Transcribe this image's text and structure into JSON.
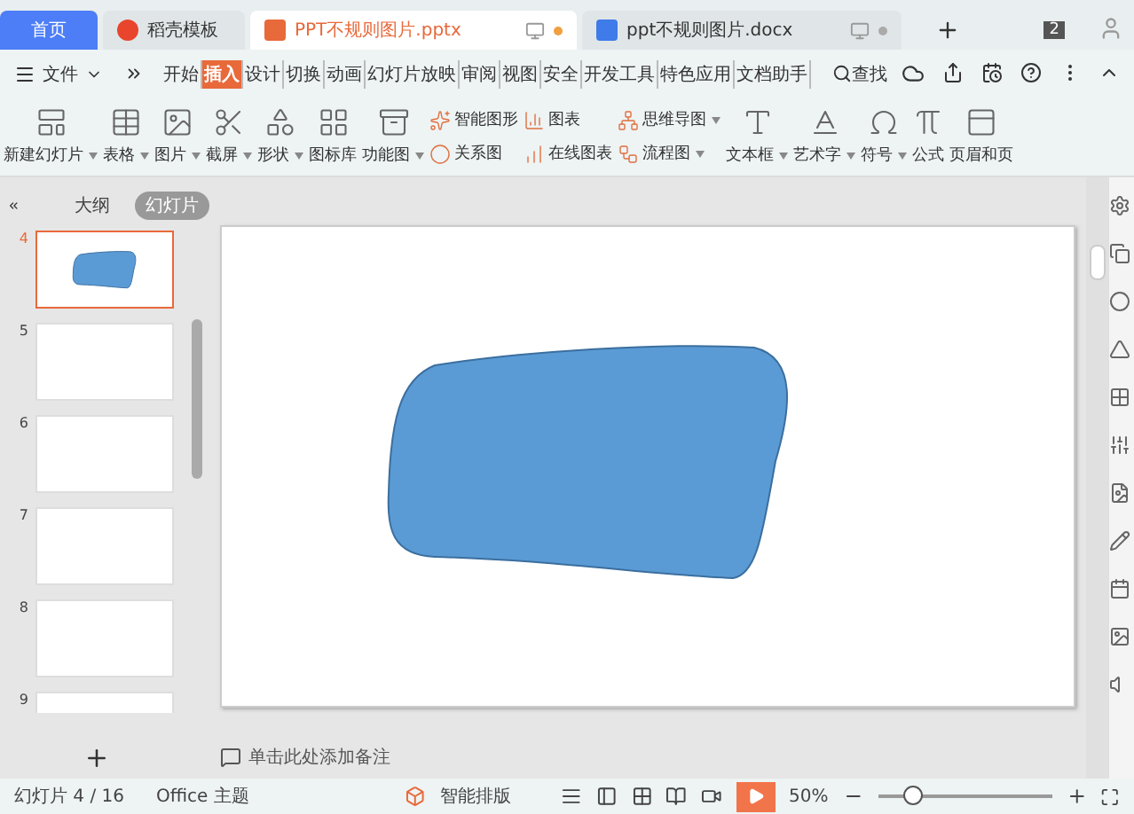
{
  "tabs": [
    {
      "label": "首页",
      "kind": "home",
      "selected": false
    },
    {
      "label": "稻壳模板",
      "kind": "docer",
      "selected": false
    },
    {
      "label": "PPT不规则图片.pptx",
      "kind": "ppt",
      "selected": true
    },
    {
      "label": "ppt不规则图片.docx",
      "kind": "doc",
      "selected": false
    }
  ],
  "window_count": "2",
  "menu": {
    "file": "文件",
    "items": [
      {
        "label": "开始",
        "selected": false
      },
      {
        "label": "插入",
        "selected": true
      },
      {
        "label": "设计",
        "selected": false
      },
      {
        "label": "切换",
        "selected": false
      },
      {
        "label": "动画",
        "selected": false
      },
      {
        "label": "幻灯片放映",
        "selected": false
      },
      {
        "label": "审阅",
        "selected": false
      },
      {
        "label": "视图",
        "selected": false
      },
      {
        "label": "安全",
        "selected": false
      },
      {
        "label": "开发工具",
        "selected": false
      },
      {
        "label": "特色应用",
        "selected": false
      },
      {
        "label": "文档助手",
        "selected": false
      }
    ],
    "search": "查找"
  },
  "ribbon": [
    {
      "kind": "big",
      "label": "新建幻灯片",
      "dropdown": true
    },
    {
      "kind": "big",
      "label": "表格",
      "dropdown": true
    },
    {
      "kind": "big",
      "label": "图片",
      "dropdown": true
    },
    {
      "kind": "big",
      "label": "截屏",
      "dropdown": true
    },
    {
      "kind": "big",
      "label": "形状",
      "dropdown": true
    },
    {
      "kind": "big",
      "label": "图标库",
      "dropdown": false
    },
    {
      "kind": "big",
      "label": "功能图",
      "dropdown": true
    },
    {
      "kind": "pair",
      "top": "智能图形",
      "bottom": "关系图",
      "dropdown": false
    },
    {
      "kind": "pair",
      "top": "图表",
      "bottom": "在线图表",
      "dropdown": false
    },
    {
      "kind": "pair",
      "top": "思维导图",
      "bottom": "流程图",
      "dropdown": true
    },
    {
      "kind": "big",
      "label": "文本框",
      "dropdown": true
    },
    {
      "kind": "big",
      "label": "艺术字",
      "dropdown": true
    },
    {
      "kind": "big",
      "label": "符号",
      "dropdown": true
    },
    {
      "kind": "big",
      "label": "公式",
      "dropdown": false
    },
    {
      "kind": "big",
      "label": "页眉和页",
      "dropdown": false
    }
  ],
  "panel_tabs": [
    {
      "label": "大纲",
      "selected": false
    },
    {
      "label": "幻灯片",
      "selected": true
    }
  ],
  "slides": [
    {
      "number": "4",
      "selected": true,
      "kind": "shape"
    },
    {
      "number": "5",
      "selected": false,
      "kind": "blank"
    },
    {
      "number": "6",
      "selected": false,
      "kind": "blank"
    },
    {
      "number": "7",
      "selected": false,
      "kind": "blank"
    },
    {
      "number": "8",
      "selected": false,
      "kind": "blank"
    },
    {
      "number": "9",
      "selected": false,
      "kind": "blank"
    }
  ],
  "notes_placeholder": "单击此处添加备注",
  "status_bar": {
    "slide": "幻灯片 4 / 16",
    "theme": "Office 主题",
    "smart_layout": "智能排版",
    "zoom": "50%",
    "level": 0.2
  }
}
